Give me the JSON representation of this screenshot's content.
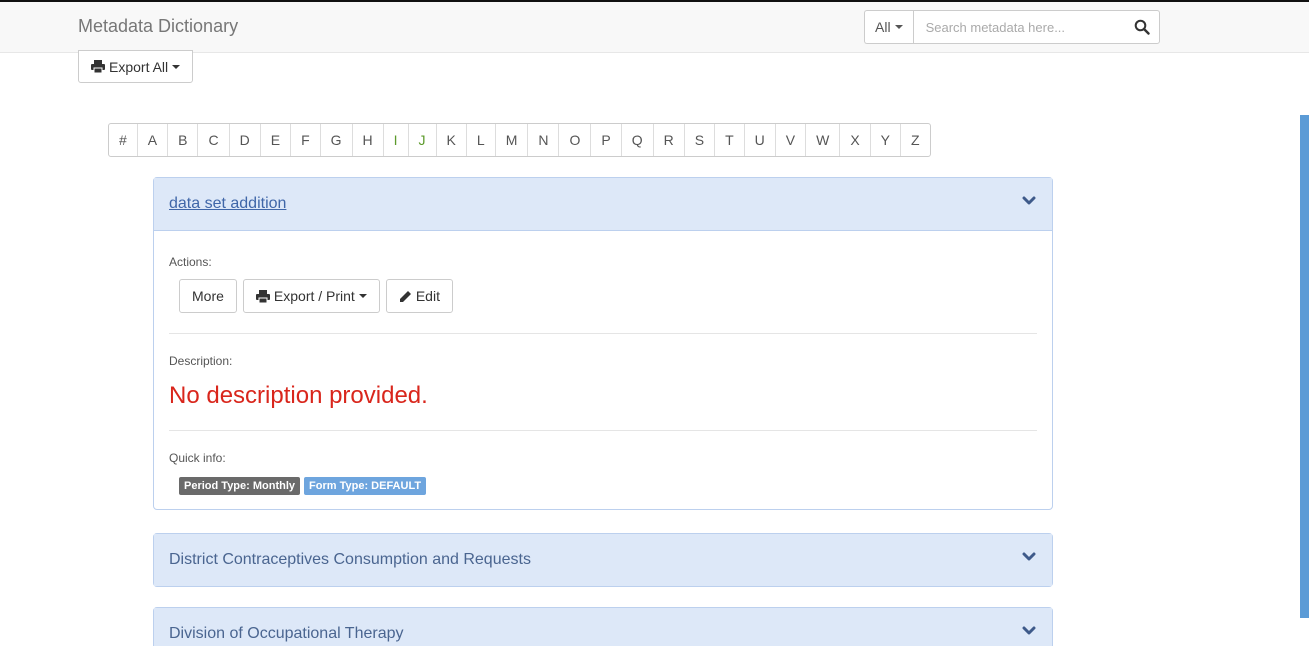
{
  "app": {
    "brand": "Metadata Dictionary"
  },
  "search": {
    "filter_label": "All",
    "placeholder": "Search metadata here..."
  },
  "export_all": {
    "label": "Export All"
  },
  "alphabet": [
    "#",
    "A",
    "B",
    "C",
    "D",
    "E",
    "F",
    "G",
    "H",
    "I",
    "J",
    "K",
    "L",
    "M",
    "N",
    "O",
    "P",
    "Q",
    "R",
    "S",
    "T",
    "U",
    "V",
    "W",
    "X",
    "Y",
    "Z"
  ],
  "expanded_item": {
    "title": "data set addition",
    "actions_label": "Actions:",
    "actions": {
      "more": "More",
      "export_print": "Export / Print",
      "edit": "Edit"
    },
    "description_label": "Description:",
    "description": "No description provided.",
    "quick_info_label": "Quick info:",
    "badges": [
      "Period Type: Monthly",
      "Form Type: DEFAULT"
    ]
  },
  "collapsed_items": [
    "District Contraceptives Consumption and Requests",
    "Division of Occupational Therapy"
  ],
  "colors": {
    "accent": "#3f66a8",
    "panel_header": "#dde8f8",
    "error": "#d9261c",
    "badge_gray": "#6a6a6a",
    "badge_blue": "#6ea5de",
    "scrollbar": "#5b9bd6"
  },
  "icons": {
    "search": "search-icon",
    "print": "printer-icon",
    "edit": "pencil-icon",
    "expand": "chevron-down-icon"
  }
}
